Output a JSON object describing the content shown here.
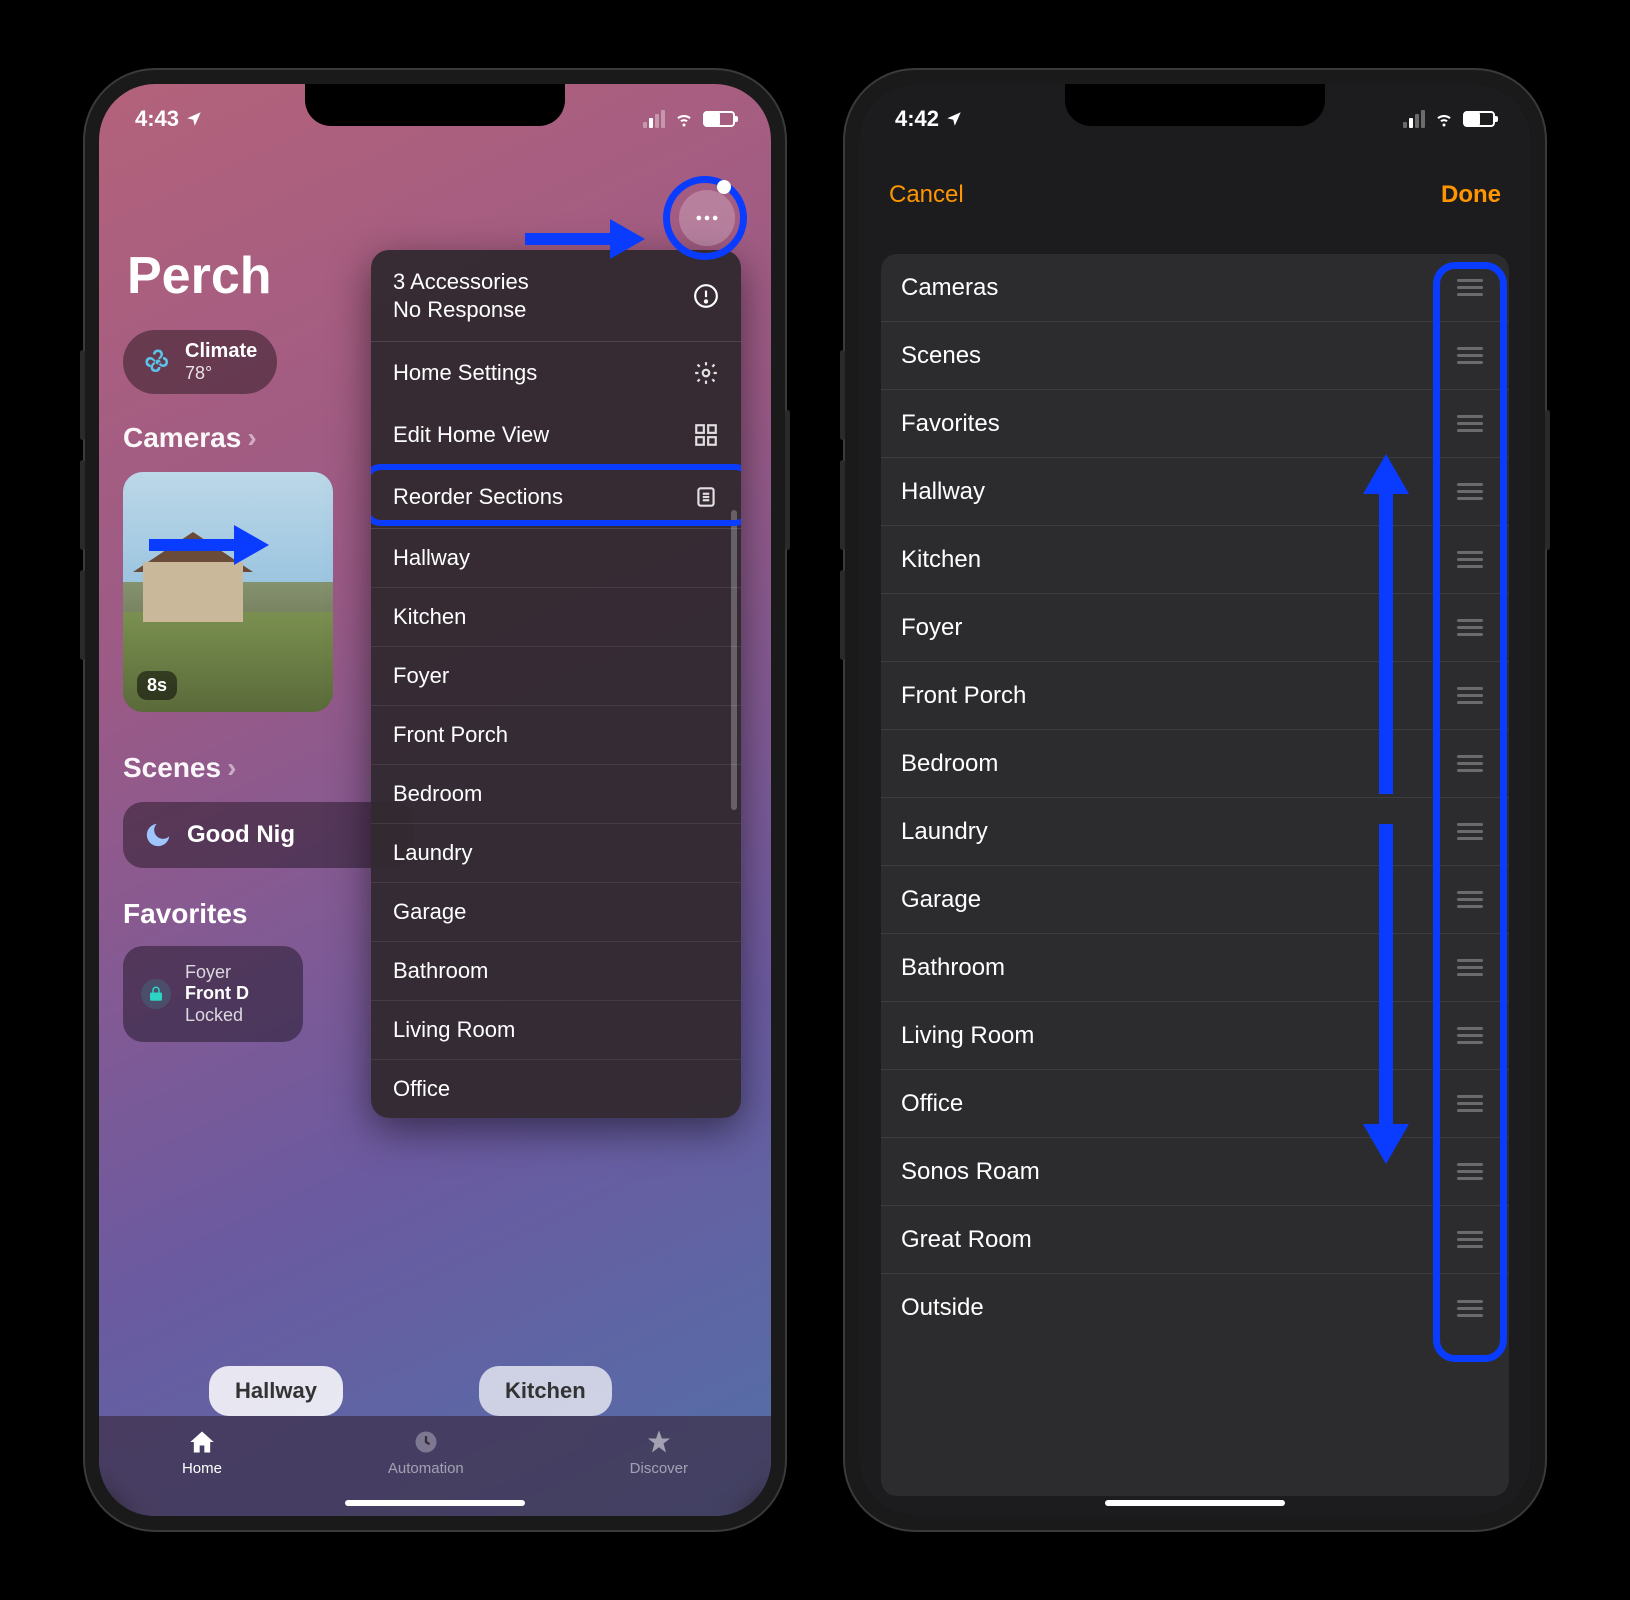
{
  "phoneLeft": {
    "status": {
      "time": "4:43"
    },
    "homeName": "Perch",
    "climate": {
      "label": "Climate",
      "temp": "78°"
    },
    "sections": {
      "cameras": "Cameras",
      "scenes": "Scenes",
      "favorites": "Favorites"
    },
    "camera": {
      "age": "8s"
    },
    "scene": {
      "name": "Good Nig"
    },
    "favTile": {
      "line1": "Foyer",
      "line2": "Front D",
      "line3": "Locked"
    },
    "roomPills": {
      "p1": "Hallway",
      "p2": "Kitchen"
    },
    "tabs": {
      "home": "Home",
      "automation": "Automation",
      "discover": "Discover"
    },
    "menu": {
      "accLine1": "3 Accessories",
      "accLine2": "No Response",
      "homeSettings": "Home Settings",
      "editHomeView": "Edit Home View",
      "reorderSections": "Reorder Sections",
      "rooms": [
        "Hallway",
        "Kitchen",
        "Foyer",
        "Front Porch",
        "Bedroom",
        "Laundry",
        "Garage",
        "Bathroom",
        "Living Room",
        "Office"
      ]
    }
  },
  "phoneRight": {
    "status": {
      "time": "4:42"
    },
    "nav": {
      "cancel": "Cancel",
      "done": "Done"
    },
    "items": [
      "Cameras",
      "Scenes",
      "Favorites",
      "Hallway",
      "Kitchen",
      "Foyer",
      "Front Porch",
      "Bedroom",
      "Laundry",
      "Garage",
      "Bathroom",
      "Living Room",
      "Office",
      "Sonos Roam",
      "Great Room",
      "Outside"
    ]
  }
}
